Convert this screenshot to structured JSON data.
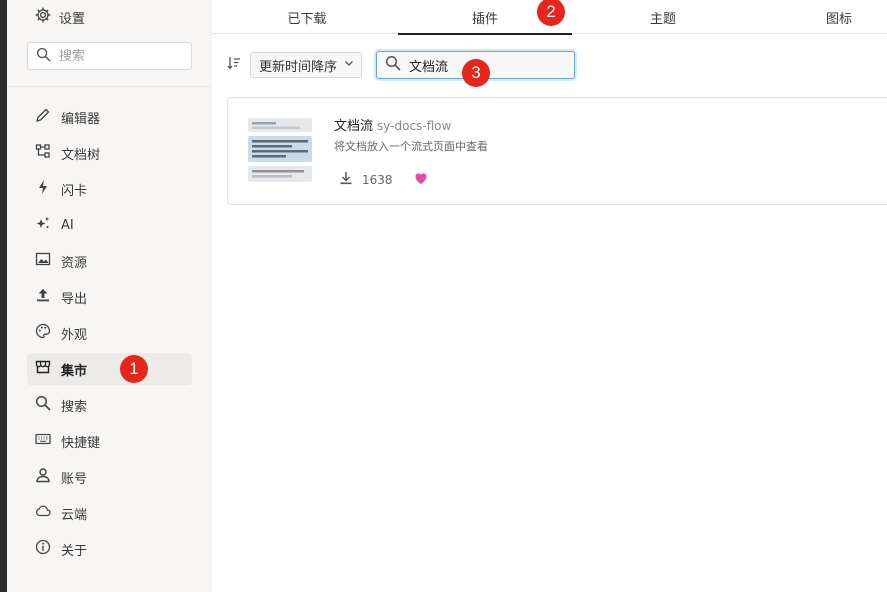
{
  "sidebar": {
    "settings_label": "设置",
    "search_placeholder": "搜索",
    "items": [
      {
        "label": "编辑器",
        "icon": "pencil-icon"
      },
      {
        "label": "文档树",
        "icon": "tree-icon"
      },
      {
        "label": "闪卡",
        "icon": "flash-icon"
      },
      {
        "label": "AI",
        "icon": "sparkle-icon"
      },
      {
        "label": "资源",
        "icon": "image-icon"
      },
      {
        "label": "导出",
        "icon": "upload-icon"
      },
      {
        "label": "外观",
        "icon": "palette-icon"
      },
      {
        "label": "集市",
        "icon": "store-icon",
        "active": true
      },
      {
        "label": "搜索",
        "icon": "search-icon"
      },
      {
        "label": "快捷键",
        "icon": "keyboard-icon"
      },
      {
        "label": "账号",
        "icon": "user-icon"
      },
      {
        "label": "云端",
        "icon": "cloud-icon"
      },
      {
        "label": "关于",
        "icon": "info-icon"
      }
    ]
  },
  "tabs": [
    {
      "label": "已下载"
    },
    {
      "label": "插件",
      "active": true
    },
    {
      "label": "主题"
    },
    {
      "label": "图标"
    }
  ],
  "toolbar": {
    "sort_label": "更新时间降序",
    "search_value": "文档流"
  },
  "plugin": {
    "name": "文档流",
    "package": "sy-docs-flow",
    "description": "将文档放入一个流式页面中查看",
    "downloads": "1638"
  },
  "annotations": {
    "step1": "1",
    "step2": "2",
    "step3": "3"
  },
  "colors": {
    "badge": "#e5271b",
    "heart": "#e24aa8",
    "focus_border": "#6aa6d3"
  }
}
